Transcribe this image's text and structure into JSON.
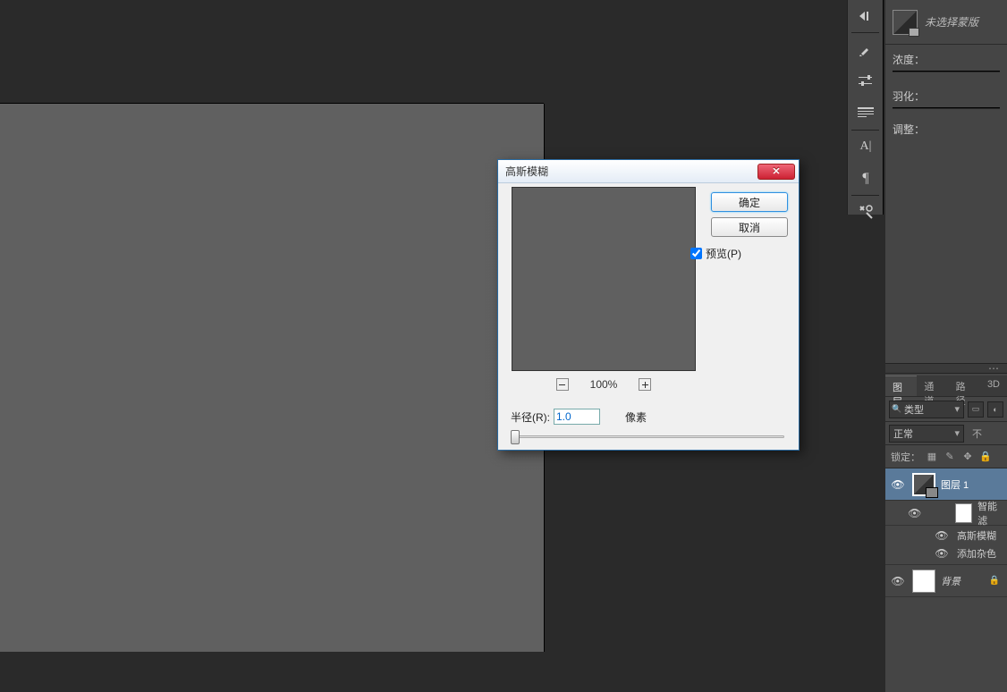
{
  "workspace": {},
  "masks": {
    "unselected": "未选择蒙版",
    "density": "浓度：",
    "feather": "羽化：",
    "adjust": "调整："
  },
  "layers_panel": {
    "tabs": [
      "图层",
      "通道",
      "路径",
      "3D"
    ],
    "kind": "类型",
    "blend": "正常",
    "opacity_lbl": "不",
    "lock_label": "锁定：",
    "layers": [
      {
        "name": "图层 1"
      },
      {
        "name": "智能滤"
      },
      {
        "name": "高斯模糊"
      },
      {
        "name": "添加杂色"
      },
      {
        "name": "背景"
      }
    ]
  },
  "dialog": {
    "title": "高斯模糊",
    "ok": "确定",
    "cancel": "取消",
    "preview_label": "预览(P)",
    "zoom": "100%",
    "radius_label": "半径(R):",
    "radius_value": "1.0",
    "unit": "像素"
  }
}
